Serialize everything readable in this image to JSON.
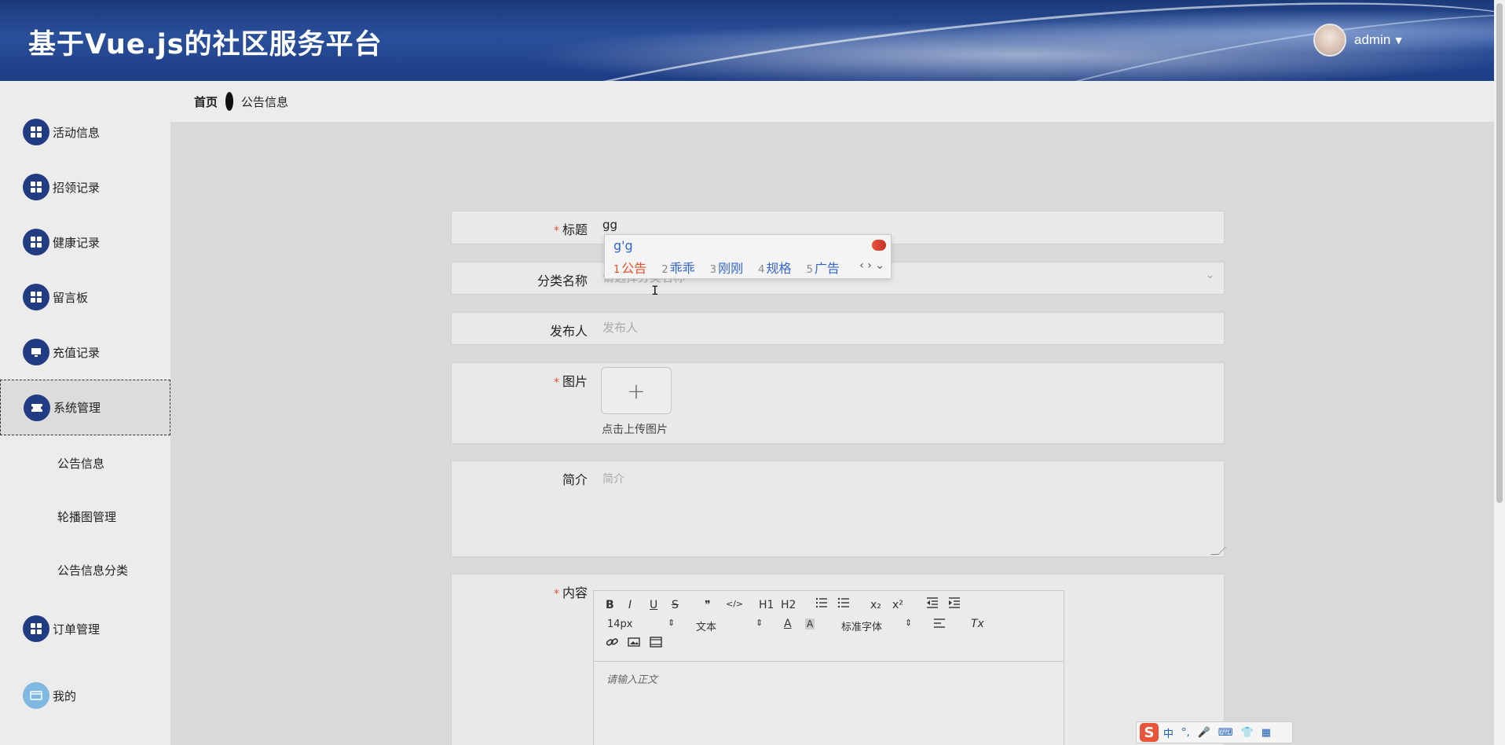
{
  "header": {
    "title": "基于Vue.js的社区服务平台",
    "username": "admin"
  },
  "sidebar": {
    "items": [
      {
        "label": "活动信息",
        "icon": "grid-icon"
      },
      {
        "label": "招领记录",
        "icon": "grid-icon"
      },
      {
        "label": "健康记录",
        "icon": "grid-icon"
      },
      {
        "label": "留言板",
        "icon": "grid-icon"
      },
      {
        "label": "充值记录",
        "icon": "monitor-icon"
      },
      {
        "label": "系统管理",
        "icon": "ticket-icon"
      }
    ],
    "sub_items": [
      "公告信息",
      "轮播图管理",
      "公告信息分类"
    ],
    "bottom_items": [
      {
        "label": "订单管理",
        "icon": "grid-icon"
      },
      {
        "label": "我的",
        "icon": "card-icon"
      }
    ]
  },
  "breadcrumb": {
    "home": "首页",
    "current": "公告信息"
  },
  "form": {
    "title_label": "标题",
    "title_value": "gg",
    "category_label": "分类名称",
    "category_placeholder": "请选择分类名称",
    "publisher_label": "发布人",
    "publisher_placeholder": "发布人",
    "image_label": "图片",
    "upload_plus": "+",
    "upload_hint": "点击上传图片",
    "intro_label": "简介",
    "intro_placeholder": "简介",
    "content_label": "内容",
    "content_placeholder": "请输入正文"
  },
  "editor_toolbar": {
    "bold": "B",
    "italic": "I",
    "underline": "U",
    "strike": "S",
    "quote": "❞",
    "code": "</>",
    "h1": "H1",
    "h2": "H2",
    "size": "14px",
    "format": "文本",
    "font": "标准字体",
    "sub": "x₂",
    "sup": "x²",
    "clean": "Tx"
  },
  "ime": {
    "pinyin": "g'g",
    "candidates": [
      {
        "num": "1",
        "text": "公告"
      },
      {
        "num": "2",
        "text": "乖乖"
      },
      {
        "num": "3",
        "text": "刚刚"
      },
      {
        "num": "4",
        "text": "规格"
      },
      {
        "num": "5",
        "text": "广告"
      }
    ],
    "nav": "‹ › ⌄",
    "status": [
      "中",
      "°,",
      "🎤",
      "⌨",
      "👕",
      "▦"
    ]
  },
  "colors": {
    "header": "#1d3d85",
    "menu_icon": "#223c83",
    "required": "#e74c3c",
    "ime_first": "#e5502c"
  }
}
